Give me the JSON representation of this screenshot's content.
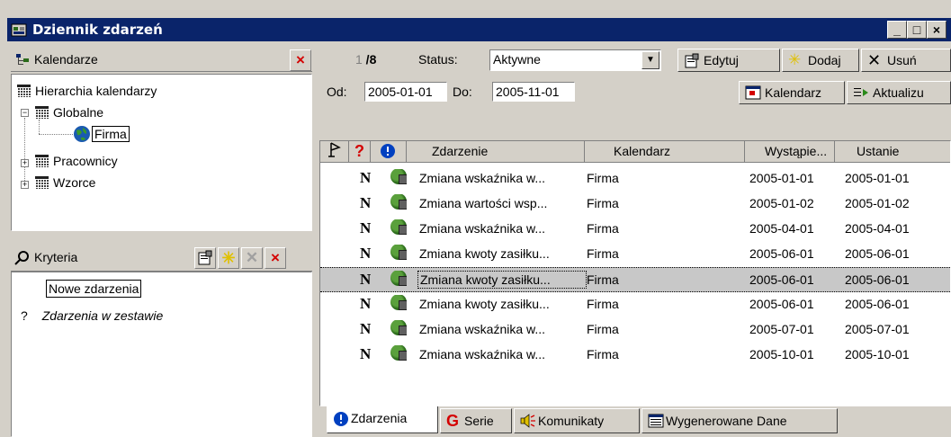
{
  "window": {
    "title": "Dziennik zdarzeń",
    "controls": [
      "_",
      "□",
      "×"
    ]
  },
  "calendars_panel": {
    "title": "Kalendarze",
    "tree": {
      "root": "Hierarchia kalendarzy",
      "items": [
        {
          "label": "Globalne",
          "expanded": true,
          "children": [
            {
              "label": "Firma",
              "selected": true
            }
          ]
        },
        {
          "label": "Pracownicy",
          "expanded": false
        },
        {
          "label": "Wzorce",
          "expanded": false
        }
      ]
    }
  },
  "criteria_panel": {
    "title": "Kryteria",
    "items": [
      {
        "prefix": "",
        "label": "Nowe zdarzenia"
      },
      {
        "prefix": "?",
        "label": "Zdarzenia w zestawie"
      }
    ]
  },
  "toolbar": {
    "counter": {
      "current": "1",
      "total": "8"
    },
    "status_label": "Status:",
    "status_value": "Aktywne",
    "edit_label": "Edytuj",
    "add_label": "Dodaj",
    "delete_label": "Usuń",
    "from_label": "Od:",
    "from_value": "2005-01-01",
    "to_label": "Do:",
    "to_value": "2005-11-01",
    "calendar_label": "Kalendarz",
    "refresh_label": "Aktualizu"
  },
  "grid": {
    "columns": [
      "Zdarzenie",
      "Kalendarz",
      "Wystąpie...",
      "Ustanie"
    ],
    "rows": [
      {
        "mark": "N",
        "event": "Zmiana wskaźnika w...",
        "calendar": "Firma",
        "start": "2005-01-01",
        "end": "2005-01-01",
        "selected": false
      },
      {
        "mark": "N",
        "event": "Zmiana wartości wsp...",
        "calendar": "Firma",
        "start": "2005-01-02",
        "end": "2005-01-02",
        "selected": false
      },
      {
        "mark": "N",
        "event": "Zmiana wskaźnika w...",
        "calendar": "Firma",
        "start": "2005-04-01",
        "end": "2005-04-01",
        "selected": false
      },
      {
        "mark": "N",
        "event": "Zmiana kwoty zasiłku...",
        "calendar": "Firma",
        "start": "2005-06-01",
        "end": "2005-06-01",
        "selected": false
      },
      {
        "mark": "N",
        "event": "Zmiana kwoty zasiłku...",
        "calendar": "Firma",
        "start": "2005-06-01",
        "end": "2005-06-01",
        "selected": true
      },
      {
        "mark": "N",
        "event": "Zmiana kwoty zasiłku...",
        "calendar": "Firma",
        "start": "2005-06-01",
        "end": "2005-06-01",
        "selected": false
      },
      {
        "mark": "N",
        "event": "Zmiana wskaźnika w...",
        "calendar": "Firma",
        "start": "2005-07-01",
        "end": "2005-07-01",
        "selected": false
      },
      {
        "mark": "N",
        "event": "Zmiana wskaźnika w...",
        "calendar": "Firma",
        "start": "2005-10-01",
        "end": "2005-10-01",
        "selected": false
      }
    ]
  },
  "tabs": [
    {
      "label": "Zdarzenia",
      "icon": "info-icon",
      "active": true
    },
    {
      "label": "Serie",
      "icon": "series-icon",
      "active": false
    },
    {
      "label": "Komunikaty",
      "icon": "speaker-icon",
      "active": false
    },
    {
      "label": "Wygenerowane Dane",
      "icon": "data-icon",
      "active": false
    }
  ],
  "colors": {
    "titlebar": "#0a246a",
    "face": "#d4d0c8",
    "red": "#d40000",
    "blue": "#0040c0"
  }
}
